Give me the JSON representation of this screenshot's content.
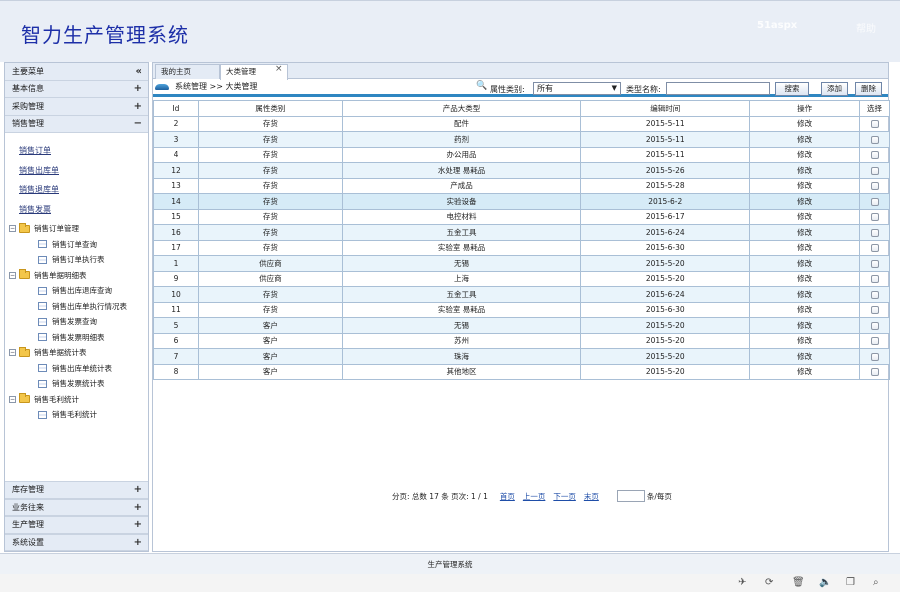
{
  "header": {
    "title": "智力生产管理系统",
    "brand": "51aspx",
    "link": "帮助"
  },
  "sidebar": {
    "title": "主要菜单",
    "collapse_glyph": "«",
    "groups_top": [
      {
        "label": "基本信息",
        "sign": "+"
      },
      {
        "label": "采购管理",
        "sign": "+"
      },
      {
        "label": "销售管理",
        "sign": "−"
      }
    ],
    "links": [
      "销售订单",
      "销售出库单",
      "销售退库单",
      "销售发票"
    ],
    "tree": [
      {
        "label": "销售订单管理",
        "children": [
          "销售订单查询",
          "销售订单执行表"
        ]
      },
      {
        "label": "销售单据明细表",
        "children": [
          "销售出库退库查询",
          "销售出库单执行情况表",
          "销售发票查询",
          "销售发票明细表"
        ]
      },
      {
        "label": "销售单据统计表",
        "children": [
          "销售出库单统计表",
          "销售发票统计表"
        ]
      },
      {
        "label": "销售毛利统计",
        "children": [
          "销售毛利统计"
        ]
      }
    ],
    "groups_bottom": [
      {
        "label": "库存管理",
        "sign": "+"
      },
      {
        "label": "业务往来",
        "sign": "+"
      },
      {
        "label": "生产管理",
        "sign": "+"
      },
      {
        "label": "系统设置",
        "sign": "+"
      }
    ]
  },
  "tabs": {
    "home": "我的主页",
    "active": "大类管理",
    "close": "×"
  },
  "toolbar": {
    "breadcrumb": "系统管理 >> 大类管理",
    "filter_label": "属性类别:",
    "filter_value": "所有",
    "name_label": "类型名称:",
    "search": "搜索",
    "add": "添加",
    "delete": "删除"
  },
  "grid": {
    "columns": [
      "Id",
      "属性类别",
      "产品大类型",
      "编辑时间",
      "操作",
      "选择"
    ],
    "edit_label": "修改",
    "rows": [
      [
        "2",
        "存货",
        "配件",
        "2015-5-11"
      ],
      [
        "3",
        "存货",
        "药剂",
        "2015-5-11"
      ],
      [
        "4",
        "存货",
        "办公用品",
        "2015-5-11"
      ],
      [
        "12",
        "存货",
        "水处理 易耗品",
        "2015-5-26"
      ],
      [
        "13",
        "存货",
        "产成品",
        "2015-5-28"
      ],
      [
        "14",
        "存货",
        "实验设备",
        "2015-6-2"
      ],
      [
        "15",
        "存货",
        "电控材料",
        "2015-6-17"
      ],
      [
        "16",
        "存货",
        "五金工具",
        "2015-6-24"
      ],
      [
        "17",
        "存货",
        "实验室 易耗品",
        "2015-6-30"
      ],
      [
        "1",
        "供应商",
        "无锡",
        "2015-5-20"
      ],
      [
        "9",
        "供应商",
        "上海",
        "2015-5-20"
      ],
      [
        "10",
        "存货",
        "五金工具",
        "2015-6-24"
      ],
      [
        "11",
        "存货",
        "实验室 易耗品",
        "2015-6-30"
      ],
      [
        "5",
        "客户",
        "无锡",
        "2015-5-20"
      ],
      [
        "6",
        "客户",
        "苏州",
        "2015-5-20"
      ],
      [
        "7",
        "客户",
        "珠海",
        "2015-5-20"
      ],
      [
        "8",
        "客户",
        "其他地区",
        "2015-5-20"
      ]
    ]
  },
  "pager": {
    "summary": "分页: 总数 17 条 页次: 1 / 1",
    "first": "首页",
    "prev": "上一页",
    "next": "下一页",
    "last": "末页",
    "per_page": "条/每页"
  },
  "footer": {
    "text": "生产管理系统"
  },
  "tray": [
    "rocket-icon",
    "refresh-icon",
    "trash-icon",
    "volume-icon",
    "window-icon",
    "search-icon"
  ]
}
